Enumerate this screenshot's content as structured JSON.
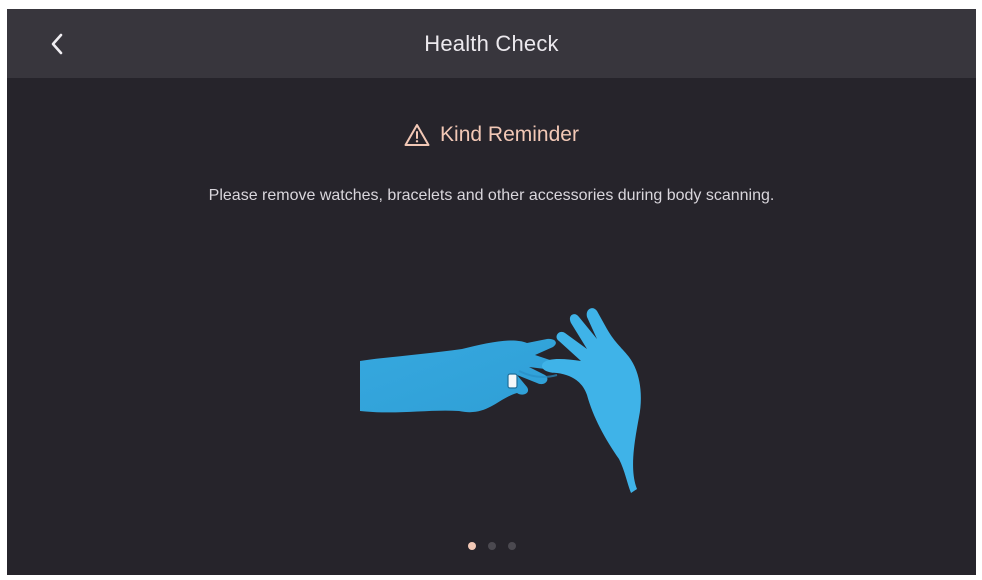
{
  "header": {
    "title": "Health Check",
    "back_icon": "chevron-left-icon"
  },
  "reminder": {
    "icon": "warning-triangle-icon",
    "title": "Kind Reminder",
    "message": "Please remove watches, bracelets and other accessories during body scanning."
  },
  "illustration": {
    "icon": "hands-removing-ring-icon"
  },
  "pager": {
    "total": 3,
    "active_index": 0
  },
  "colors": {
    "background": "#26242b",
    "header_background": "#38363d",
    "accent": "#f2c8b6",
    "illustration": "#3aa9dd"
  }
}
